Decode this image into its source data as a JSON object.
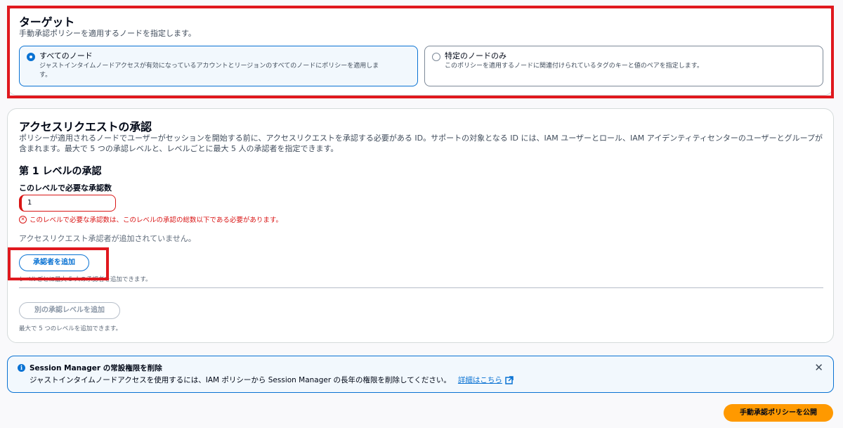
{
  "target": {
    "title": "ターゲット",
    "description": "手動承認ポリシーを適用するノードを指定します。",
    "options": [
      {
        "label": "すべてのノード",
        "description": "ジャストインタイムノードアクセスが有効になっているアカウントとリージョンのすべてのノードにポリシーを適用しま\nす。",
        "selected": true
      },
      {
        "label": "特定のノードのみ",
        "description": "このポリシーを適用するノードに関連付けられているタグのキーと値のペアを指定します。",
        "selected": false
      }
    ]
  },
  "approval": {
    "title": "アクセスリクエストの承認",
    "description": "ポリシーが適用されるノードでユーザーがセッションを開始する前に、アクセスリクエストを承認する必要がある ID。サポートの対象となる ID には、IAM ユーザーとロール、IAM アイデンティティセンターのユーザーとグループが含まれます。最大で 5 つの承認レベルと、レベルごとに最大 5 人の承認者を指定できます。",
    "level_title": "第 1 レベルの承認",
    "required_label": "このレベルで必要な承認数",
    "required_value": "1",
    "error_text": "このレベルで必要な承認数は、このレベルの承認の総数以下である必要があります。",
    "no_approvers": "アクセスリクエスト承認者が追加されていません。",
    "add_approver_button": "承認者を追加",
    "add_approver_hint": "レベルごとに最大 5 人の承認者を追加できます。",
    "add_level_button": "別の承認レベルを追加",
    "add_level_hint": "最大で 5 つのレベルを追加できます。"
  },
  "flash": {
    "title": "Session Manager の常設権限を削除",
    "text": "ジャストインタイムノードアクセスを使用するには、IAM ポリシーから Session Manager の長年の権限を削除してください。",
    "link": "詳細はこちら"
  },
  "footer": {
    "publish_button": "手動承認ポリシーを公開"
  },
  "colors": {
    "accent": "#0972d3",
    "error": "#d91515",
    "primary_button": "#ff9900",
    "highlight_box": "#e0181e"
  }
}
